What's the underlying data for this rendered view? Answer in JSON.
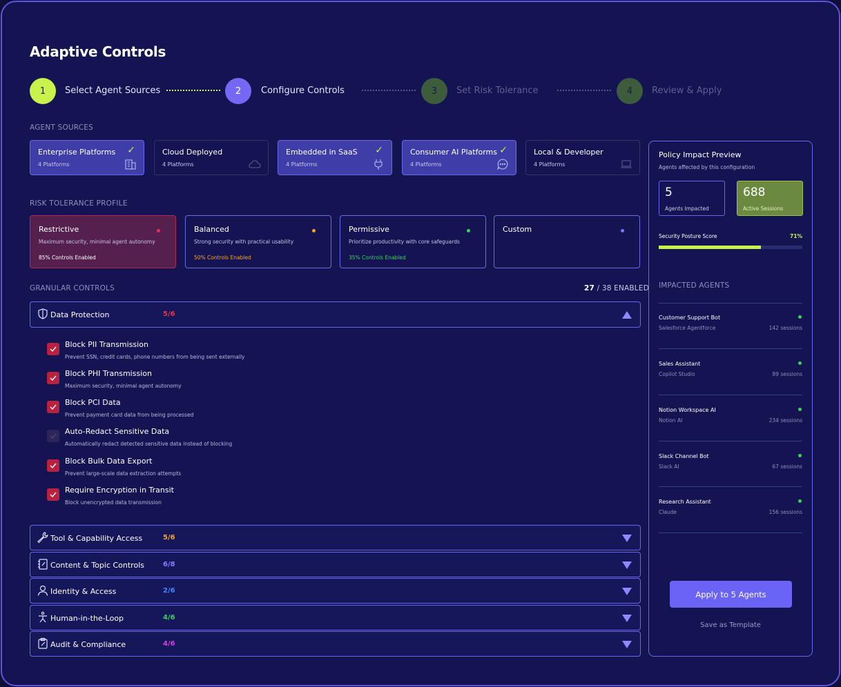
{
  "title": "Adaptive Controls",
  "steps": [
    {
      "num": "1",
      "label": "Select Agent Sources"
    },
    {
      "num": "2",
      "label": "Configure Controls"
    },
    {
      "num": "3",
      "label": "Set Risk Tolerance"
    },
    {
      "num": "4",
      "label": "Review & Apply"
    }
  ],
  "agent_sources": {
    "label": "AGENT SOURCES",
    "items": [
      {
        "title": "Enterprise Platforms",
        "sub": "4 Platforms",
        "selected": true,
        "icon": "building-icon"
      },
      {
        "title": "Cloud Deployed",
        "sub": "4 Platforms",
        "selected": false,
        "icon": "cloud-icon"
      },
      {
        "title": "Embedded in SaaS",
        "sub": "4 Platforms",
        "selected": true,
        "icon": "plug-icon"
      },
      {
        "title": "Consumer AI Platforms",
        "sub": "4 Platforms",
        "selected": true,
        "icon": "chat-bubble-icon"
      },
      {
        "title": "Local & Developer",
        "sub": "4 Platforms",
        "selected": false,
        "icon": "laptop-icon"
      }
    ],
    "check_glyph": "✓"
  },
  "risk": {
    "label": "RISK TOLERANCE PROFILE",
    "items": [
      {
        "title": "Restrictive",
        "desc": "Maximum security, minimal agent autonomy",
        "controls": "85% Controls Enabled",
        "color": "#e8334a"
      },
      {
        "title": "Balanced",
        "desc": "Strong security with practical usability",
        "controls": "50% Controls Enabled",
        "color": "#f5a623"
      },
      {
        "title": "Permissive",
        "desc": "Prioritize productivity with core safeguards",
        "controls": "35% Controls Enabled",
        "color": "#3ecf5e"
      },
      {
        "title": "Custom",
        "desc": "",
        "controls": "",
        "color": "#7b74ff"
      }
    ]
  },
  "granular": {
    "label": "GRANULAR CONTROLS",
    "enabled_num": "27",
    "enabled_rest": "/ 38 ENABLED",
    "expanded": {
      "name": "Data Protection",
      "count": "5/6",
      "color": "#e8334a",
      "controls": [
        {
          "title": "Block PII Transmission",
          "desc": "Prevent SSN, credit cards, phone numbers from being sent externally",
          "checked": true
        },
        {
          "title": "Block PHI Transmission",
          "desc": "Maximum security, minimal agent autonomy",
          "checked": true
        },
        {
          "title": "Block PCI Data",
          "desc": "Prevent payment card data from being processed",
          "checked": true
        },
        {
          "title": "Auto-Redact Sensitive Data",
          "desc": "Automatically redact detected sensitive data instead of blocking",
          "checked": false
        },
        {
          "title": "Block Bulk Data Export",
          "desc": "Prevent large-scale data extraction attempts",
          "checked": true
        },
        {
          "title": "Require Encryption in Transit",
          "desc": "Block unencrypted data transmission",
          "checked": true
        }
      ]
    },
    "groups": [
      {
        "name": "Tool & Capability Access",
        "count": "5/6",
        "color": "#f5a623",
        "icon": "wrench-icon"
      },
      {
        "name": "Content & Topic Controls",
        "count": "6/8",
        "color": "#8a7dff",
        "icon": "notebook-icon"
      },
      {
        "name": "Identity & Access",
        "count": "2/6",
        "color": "#3d8bff",
        "icon": "user-icon"
      },
      {
        "name": "Human-in-the-Loop",
        "count": "4/6",
        "color": "#3ecf5e",
        "icon": "person-icon"
      },
      {
        "name": "Audit & Compliance",
        "count": "4/6",
        "color": "#d63fe0",
        "icon": "clipboard-icon"
      }
    ]
  },
  "preview": {
    "title": "Policy Impact Preview",
    "subtitle": "Agents affected by this configuration",
    "agents_impacted_value": "5",
    "agents_impacted_label": "Agents Impacted",
    "active_sessions_value": "688",
    "active_sessions_label": "Active Sessions",
    "posture_label": "Security Posture Score",
    "posture_value": "71%",
    "posture_fraction": 0.71,
    "impacted_label": "IMPACTED AGENTS",
    "agents": [
      {
        "name": "Customer Support Bot",
        "platform": "Salesforce Agentforce",
        "sessions": "142 sessions"
      },
      {
        "name": "Sales Assistant",
        "platform": "Copilot Studio",
        "sessions": "89 sessions"
      },
      {
        "name": "Notion Workspace AI",
        "platform": "Notion AI",
        "sessions": "234 sessions"
      },
      {
        "name": "Slack Channel Bot",
        "platform": "Slack AI",
        "sessions": "67 sessions"
      },
      {
        "name": "Research Assistant",
        "platform": "Claude",
        "sessions": "156 sessions"
      }
    ],
    "apply_label": "Apply to 5 Agents",
    "template_label": "Save as Template"
  },
  "colors": {
    "accent": "#6a63f5",
    "lime": "#c9f24a",
    "danger": "#b8213f",
    "success_box": "#6b8a3f"
  }
}
